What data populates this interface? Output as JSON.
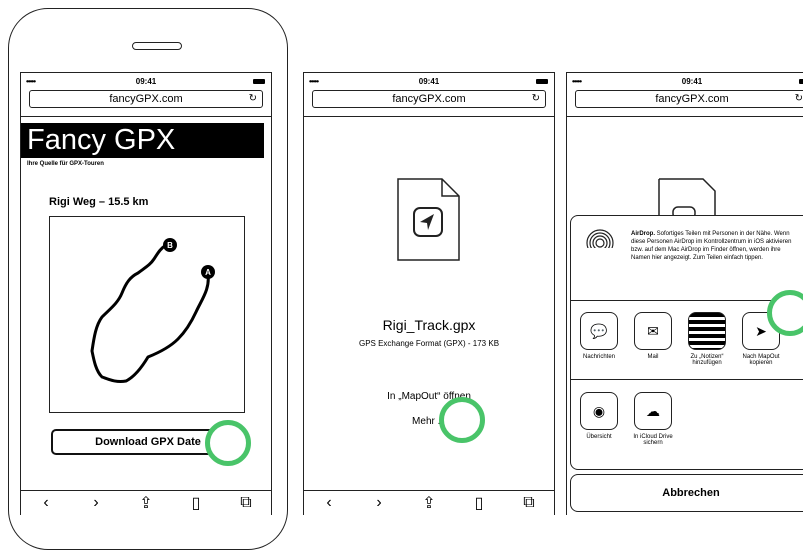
{
  "status": {
    "signal": "•••••",
    "time": "09:41"
  },
  "url": "fancyGPX.com",
  "screen1": {
    "site_title": "Fancy GPX",
    "tagline": "Ihre Quelle für GPX-Touren",
    "track": "Rigi Weg – 15.5 km",
    "download": "Download GPX Date",
    "marker_a": "A",
    "marker_b": "B"
  },
  "screen2": {
    "filename": "Rigi_Track.gpx",
    "meta": "GPS Exchange Format (GPX) - 173 KB",
    "open_in": "In „MapOut“ öffnen",
    "more": "Mehr ..."
  },
  "screen3": {
    "airdrop_bold": "AirDrop.",
    "airdrop_text": "Sofortiges Teilen mit Personen in der Nähe. Wenn diese Personen AirDrop im Kontrollzentrum in iOS aktivieren bzw. auf dem Mac AirDrop im Finder öffnen, werden ihre Namen hier angezeigt. Zum Teilen einfach tippen.",
    "apps": [
      "Nachrichten",
      "Mail",
      "Zu „Notizen“ hinzufügen",
      "Nach MapOut kopieren"
    ],
    "actions": [
      "Übersicht",
      "In iCloud Drive sichern"
    ],
    "cancel": "Abbrechen"
  },
  "toolbar_icons": [
    "back-icon",
    "forward-icon",
    "share-icon",
    "bookmarks-icon",
    "tabs-icon"
  ],
  "accent": "#49c469"
}
